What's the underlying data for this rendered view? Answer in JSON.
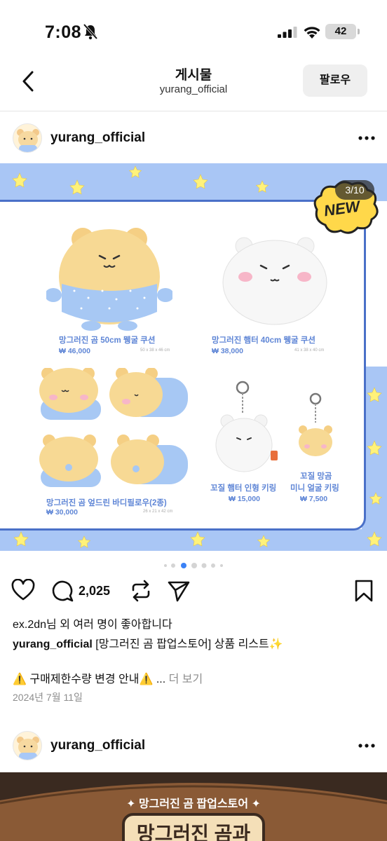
{
  "status_bar": {
    "time": "7:08",
    "battery": "42"
  },
  "header": {
    "title": "게시물",
    "subtitle": "yurang_official",
    "follow_label": "팔로우"
  },
  "post": {
    "username": "yurang_official",
    "image_counter": "3/10",
    "badge": "NEW",
    "products": [
      {
        "name": "망그러진 곰 50cm 뮁굴 쿠션",
        "price": "₩ 46,000",
        "size": "50 x 38 x 46 cm"
      },
      {
        "name": "망그러진 햄터 40cm 뮁굴 쿠션",
        "price": "₩ 38,000",
        "size": "41 x 38 x 40 cm"
      },
      {
        "name": "망그러진 곰 엎드린 바디필로우(2종)",
        "price": "₩ 30,000",
        "size": "26 x 21 x 42 cm"
      },
      {
        "name": "꼬질 햄터 인형 키링",
        "price": "₩ 15,000"
      },
      {
        "name_line1": "꼬질 망곰",
        "name_line2": "미니 얼굴 키링",
        "price": "₩ 7,500"
      }
    ],
    "comment_count": "2,025",
    "likes_text": "ex.2dn님 외 여러 명이 좋아합니다",
    "caption_user": "yurang_official",
    "caption_text": " [망그러진 곰 팝업스토어] 상품 리스트✨",
    "notice_text": "⚠️ 구매제한수량 변경 안내⚠️ ...",
    "more_label": " 더 보기",
    "date": "2024년 7월 11일"
  },
  "post2": {
    "username": "yurang_official",
    "banner": "✦ 망그러진 곰 팝업스토어 ✦",
    "title": "망그러진 곰과"
  },
  "colors": {
    "accent_blue": "#5f86d6",
    "band_blue": "#a9c6f5",
    "frame_blue": "#4a70c8",
    "active_dot": "#3b82f6"
  },
  "icons": [
    "bell-slash-icon",
    "signal-icon",
    "wifi-icon",
    "back-chevron-icon",
    "more-dots-icon",
    "heart-icon",
    "comment-icon",
    "repost-icon",
    "share-icon",
    "bookmark-icon"
  ]
}
